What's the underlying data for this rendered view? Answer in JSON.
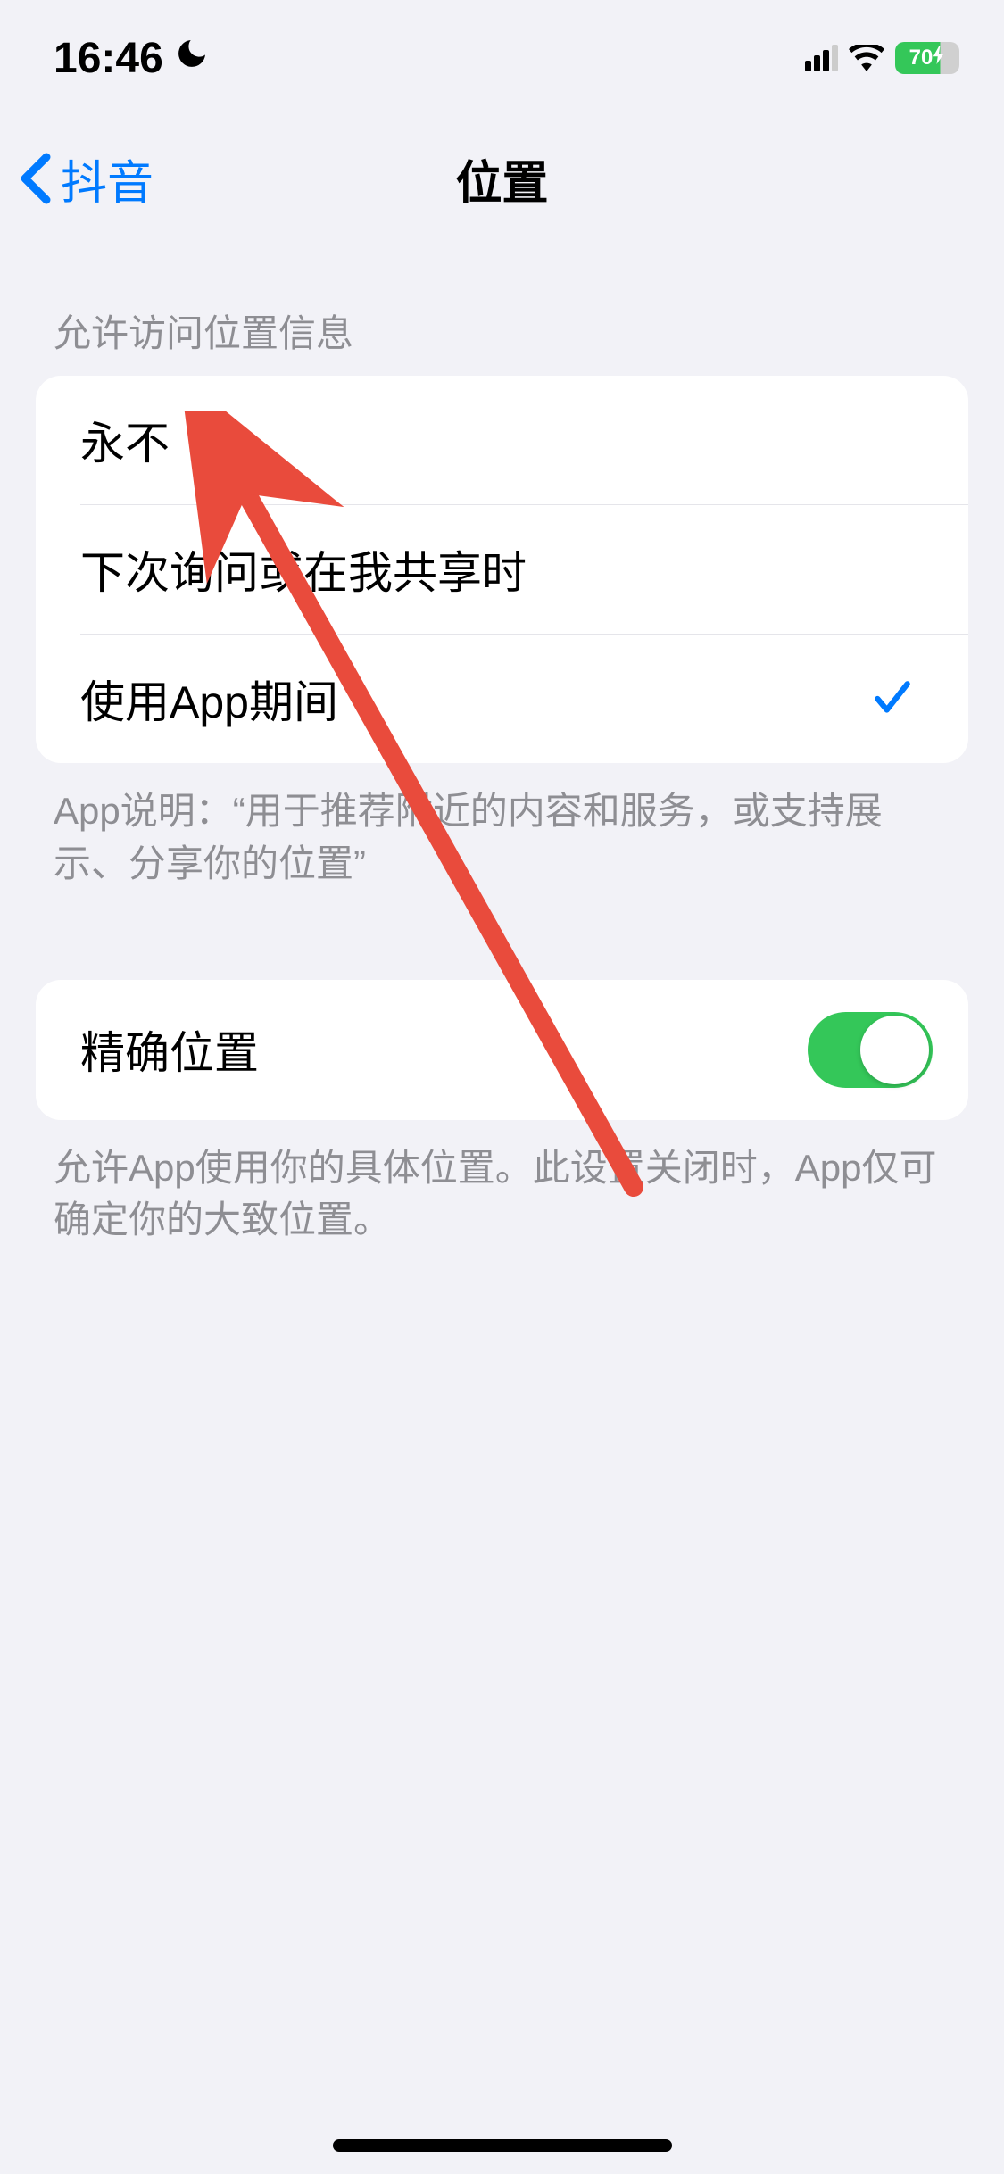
{
  "status": {
    "time": "16:46",
    "battery_percent": "70"
  },
  "nav": {
    "back_label": "抖音",
    "title": "位置"
  },
  "location_access": {
    "header": "允许访问位置信息",
    "options": {
      "never": "永不",
      "ask_next_time": "下次询问或在我共享时",
      "while_using": "使用App期间"
    },
    "selected": "while_using",
    "footer": "App说明：“用于推荐附近的内容和服务，或支持展示、分享你的位置”"
  },
  "precise_location": {
    "label": "精确位置",
    "enabled": true,
    "footer": "允许App使用你的具体位置。此设置关闭时，App仅可确定你的大致位置。"
  },
  "annotation": {
    "arrow_color": "#e94b3c"
  }
}
